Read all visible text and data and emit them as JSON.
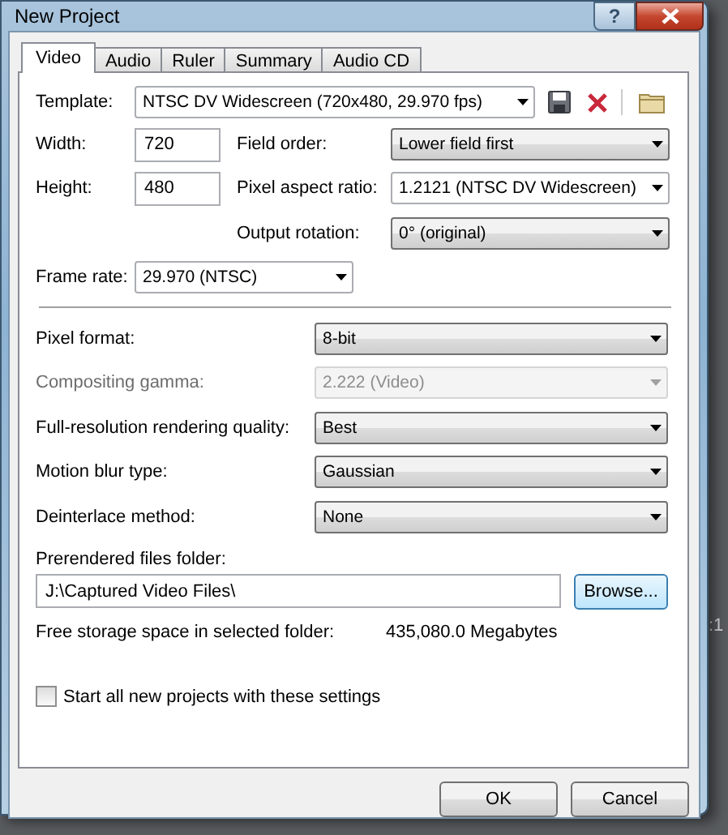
{
  "window": {
    "title": "New Project",
    "help_button": "?"
  },
  "tabs": [
    {
      "label": "Video",
      "selected": true
    },
    {
      "label": "Audio",
      "selected": false
    },
    {
      "label": "Ruler",
      "selected": false
    },
    {
      "label": "Summary",
      "selected": false
    },
    {
      "label": "Audio CD",
      "selected": false
    }
  ],
  "template": {
    "label": "Template:",
    "value": "NTSC DV Widescreen (720x480, 29.970 fps)"
  },
  "width": {
    "label": "Width:",
    "value": "720"
  },
  "height": {
    "label": "Height:",
    "value": "480"
  },
  "field_order": {
    "label": "Field order:",
    "value": "Lower field first",
    "kind": "list"
  },
  "pixel_aspect_ratio": {
    "label": "Pixel aspect ratio:",
    "value": "1.2121 (NTSC DV Widescreen)",
    "kind": "combo"
  },
  "output_rotation": {
    "label": "Output rotation:",
    "value": "0° (original)",
    "kind": "list"
  },
  "frame_rate": {
    "label": "Frame rate:",
    "value": "29.970 (NTSC)",
    "kind": "combo"
  },
  "settings": [
    {
      "label": "Pixel format:",
      "value": "8-bit",
      "disabled": false
    },
    {
      "label": "Compositing gamma:",
      "value": "2.222 (Video)",
      "disabled": true
    },
    {
      "label": "Full-resolution rendering quality:",
      "value": "Best",
      "disabled": false
    },
    {
      "label": "Motion blur type:",
      "value": "Gaussian",
      "disabled": false
    },
    {
      "label": "Deinterlace method:",
      "value": "None",
      "disabled": false
    }
  ],
  "prerendered_folder": {
    "label": "Prerendered files folder:",
    "value": "J:\\Captured Video Files\\",
    "button": "Browse..."
  },
  "free_space": {
    "label": "Free storage space in selected folder:",
    "value": "435,080.0 Megabytes"
  },
  "start_checkbox": {
    "label": "Start all new projects with these settings",
    "checked": false
  },
  "buttons": [
    "OK",
    "Cancel"
  ],
  "background_text": ":1"
}
